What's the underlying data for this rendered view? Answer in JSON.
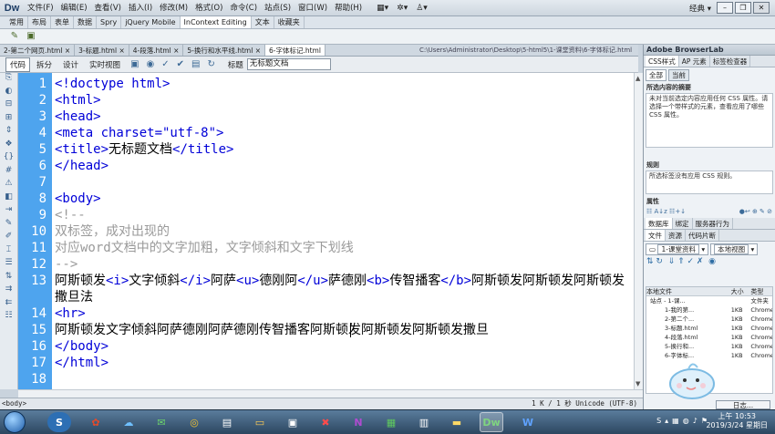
{
  "app": {
    "logo": "Dw",
    "workspace": "经典",
    "menu": [
      "文件(F)",
      "编辑(E)",
      "查看(V)",
      "插入(I)",
      "修改(M)",
      "格式(O)",
      "命令(C)",
      "站点(S)",
      "窗口(W)",
      "帮助(H)"
    ],
    "window_buttons": [
      "–",
      "❐",
      "✕"
    ]
  },
  "insert_tabs": [
    "常用",
    "布局",
    "表单",
    "数据",
    "Spry",
    "jQuery Mobile",
    "InContext Editing",
    "文本",
    "收藏夹"
  ],
  "active_insert_tab": "InContext Editing",
  "doc_tabs": [
    "2-第二个网页.html ×",
    "3-标题.html ×",
    "4-段落.html ×",
    "5-换行和水平线.html ×",
    "6-字体标记.html"
  ],
  "doc_path": "C:\\Users\\Administrator\\Desktop\\5-html5\\1-课堂资料\\6-字体标记.html",
  "doc_toolbar": {
    "views": [
      "代码",
      "拆分",
      "设计",
      "实时视图"
    ],
    "active_view": "代码",
    "title_label": "标题",
    "title_value": "无标题文档"
  },
  "code_lines": [
    {
      "n": "1",
      "html": "<span class='tag'>&lt;!doctype html&gt;</span>"
    },
    {
      "n": "2",
      "html": "<span class='tag'>&lt;html&gt;</span>"
    },
    {
      "n": "3",
      "html": "<span class='tag'>&lt;head&gt;</span>"
    },
    {
      "n": "4",
      "html": "<span class='tag'>&lt;meta charset=&quot;utf-8&quot;&gt;</span>"
    },
    {
      "n": "5",
      "html": "<span class='tag'>&lt;title&gt;</span><span class='txt'>无标题文档</span><span class='tag'>&lt;/title&gt;</span>"
    },
    {
      "n": "6",
      "html": "<span class='tag'>&lt;/head&gt;</span>"
    },
    {
      "n": "7",
      "html": ""
    },
    {
      "n": "8",
      "html": "<span class='tag'>&lt;body&gt;</span>"
    },
    {
      "n": "9",
      "html": "<span class='cmt'>&lt;!--</span>"
    },
    {
      "n": "10",
      "html": "<span class='cmt'>双标签，成对出现的</span>"
    },
    {
      "n": "11",
      "html": "<span class='cmt'>对应word文档中的文字加粗，文字倾斜和文字下划线</span>"
    },
    {
      "n": "12",
      "html": "<span class='cmt'>--&gt;</span>"
    },
    {
      "n": "13",
      "html": "阿斯顿发<span class='tag'>&lt;i&gt;</span>文字倾斜<span class='tag'>&lt;/i&gt;</span>阿萨<span class='tag'>&lt;u&gt;</span>德刚阿<span class='tag'>&lt;/u&gt;</span>萨德刚<span class='tag'>&lt;b&gt;</span>传智播客<span class='tag'>&lt;/b&gt;</span>阿斯顿发阿斯顿发阿斯顿发撒旦法",
      "wrap": true
    },
    {
      "n": "14",
      "html": "<span class='tag'>&lt;hr&gt;</span>"
    },
    {
      "n": "15",
      "html": "阿斯顿发文字倾斜阿萨德刚阿萨德刚传智播客阿斯顿发阿斯顿发阿斯顿发撒旦"
    },
    {
      "n": "16",
      "html": "<span class='tag'>&lt;/body&gt;</span>"
    },
    {
      "n": "17",
      "html": "<span class='tag'>&lt;/html&gt;</span>"
    },
    {
      "n": "18",
      "html": ""
    }
  ],
  "status": {
    "left": "<body>",
    "right": "1 K / 1 秒 Unicode (UTF-8)"
  },
  "right_panel": {
    "browserlab": "Adobe BrowserLab",
    "css_tabs": [
      "CSS样式",
      "AP 元素",
      "标签检查器"
    ],
    "css_sub": [
      "全部",
      "当前"
    ],
    "summary_title": "所选内容的摘要",
    "summary_text": "未对当前选定内容应用任何 CSS 属性。请选择一个带样式的元素，查看应用了哪些 CSS 属性。",
    "rules_title": "规则",
    "rules_text": "所选标签没有应用 CSS 规则。",
    "props_title": "属性",
    "files_tabs": [
      "数据库",
      "绑定",
      "服务器行为"
    ],
    "files_tabs2": [
      "文件",
      "资源",
      "代码片断"
    ],
    "site_select": "1-课堂资料",
    "view_select": "本地视图",
    "tree_headers": [
      "本地文件",
      "大小",
      "类型"
    ],
    "tree_rows": [
      [
        "站点 - 1-课...",
        "",
        "文件夹"
      ],
      [
        "1-我的第...",
        "1KB",
        "Chrome..."
      ],
      [
        "2-第二个...",
        "1KB",
        "Chrome..."
      ],
      [
        "3-标题.html",
        "1KB",
        "Chrome..."
      ],
      [
        "4-段落.html",
        "1KB",
        "Chrome..."
      ],
      [
        "5-换行和...",
        "1KB",
        "Chrome..."
      ],
      [
        "6-字体标...",
        "1KB",
        "Chrome..."
      ]
    ],
    "log_button": "日志..."
  },
  "taskbar": {
    "clock_time": "上午 10:53",
    "clock_date": "2019/3/24 星期日"
  }
}
